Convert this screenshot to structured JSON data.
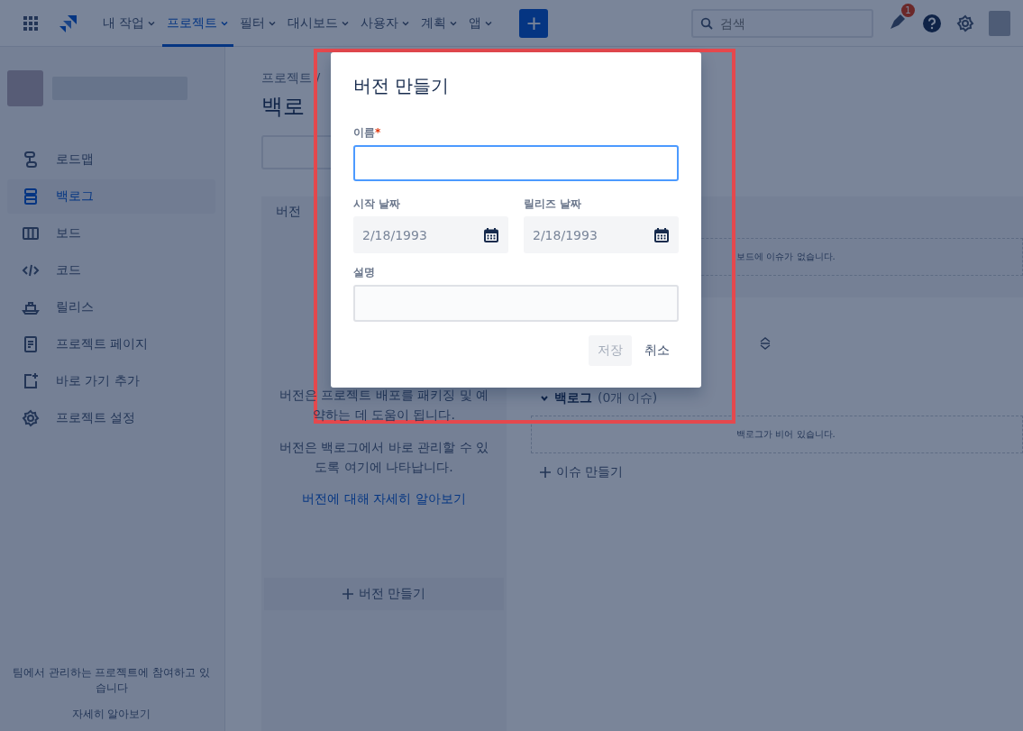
{
  "nav": {
    "items": [
      {
        "label": "내 작업",
        "selected": false
      },
      {
        "label": "프로젝트",
        "selected": true
      },
      {
        "label": "필터",
        "selected": false
      },
      {
        "label": "대시보드",
        "selected": false
      },
      {
        "label": "사용자",
        "selected": false
      },
      {
        "label": "계획",
        "selected": false
      },
      {
        "label": "앱",
        "selected": false
      }
    ],
    "create": "+",
    "search": {
      "placeholder": "검색"
    },
    "notification_count": "1"
  },
  "sidebar": {
    "items": [
      {
        "label": "로드맵",
        "kind": "roadmap",
        "selected": false
      },
      {
        "label": "백로그",
        "kind": "backlog",
        "selected": true
      },
      {
        "label": "보드",
        "kind": "board",
        "selected": false
      },
      {
        "label": "코드",
        "kind": "code",
        "selected": false
      },
      {
        "label": "릴리스",
        "kind": "release",
        "selected": false
      },
      {
        "label": "프로젝트 페이지",
        "kind": "page",
        "selected": false
      },
      {
        "label": "바로 가기 추가",
        "kind": "shortcut",
        "selected": false
      },
      {
        "label": "프로젝트 설정",
        "kind": "settings",
        "selected": false
      }
    ],
    "footer": {
      "text": "팀에서 관리하는 프로젝트에 참여하고 있습니다",
      "link": "자세히 알아보기"
    }
  },
  "main": {
    "breadcrumb": "프로젝트 /",
    "title": "백로",
    "versions": {
      "title": "버전",
      "paragraphs": [
        "버전은 프로젝트 배포를 패키징 및 예약하는 데 도움이 됩니다.",
        "버전은 백로그에서 바로 관리할 수 있도록 여기에 나타납니다."
      ],
      "link": "버전에 대해 자세히 알아보기",
      "create": "버전 만들기"
    },
    "board": {
      "empty": "보드에 이슈가 없습니다.",
      "backlog": {
        "title": "백로그",
        "count": "(0개 이슈)",
        "expanded": true,
        "empty": "백로그가 비어 있습니다."
      },
      "create_issue": "이슈 만들기"
    }
  },
  "modal": {
    "title": "버전 만들기",
    "name": {
      "label": "이름",
      "required_mark": "*",
      "focused": true
    },
    "dates": [
      {
        "label": "시작 날짜",
        "value": "2/18/1993"
      },
      {
        "label": "릴리즈 날짜",
        "value": "2/18/1993"
      }
    ],
    "description": {
      "label": "설명"
    },
    "buttons": [
      {
        "label": "저장",
        "kind": "primary",
        "disabled": true
      },
      {
        "label": "취소",
        "kind": "subtle",
        "disabled": false
      }
    ]
  }
}
